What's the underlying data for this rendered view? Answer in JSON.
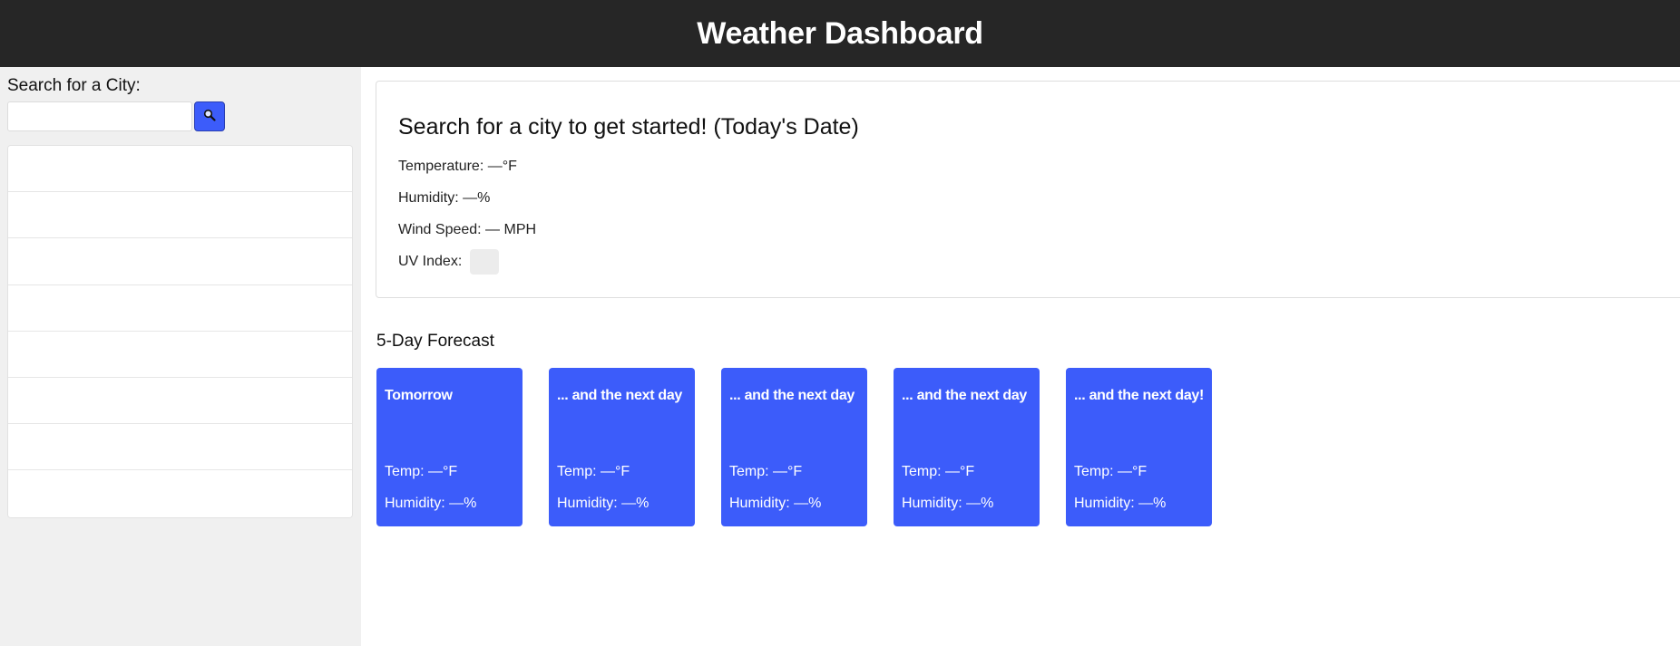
{
  "header": {
    "title": "Weather Dashboard"
  },
  "sidebar": {
    "search_label": "Search for a City:",
    "search_value": "",
    "history": [
      "",
      "",
      "",
      "",
      "",
      "",
      "",
      ""
    ]
  },
  "current": {
    "heading": "Search for a city to get started! (Today's Date)",
    "temperature": "Temperature: —°F",
    "humidity": "Humidity: —%",
    "wind": "Wind Speed: — MPH",
    "uv_label": "UV Index:",
    "uv_value": "—"
  },
  "forecast": {
    "title": "5-Day Forecast",
    "cards": [
      {
        "day": "Tomorrow",
        "temp": "Temp: —°F",
        "humidity": "Humidity: —%"
      },
      {
        "day": "... and the next day",
        "temp": "Temp: —°F",
        "humidity": "Humidity: —%"
      },
      {
        "day": "... and the next day",
        "temp": "Temp: —°F",
        "humidity": "Humidity: —%"
      },
      {
        "day": "... and the next day",
        "temp": "Temp: —°F",
        "humidity": "Humidity: —%"
      },
      {
        "day": "... and the next day!",
        "temp": "Temp: —°F",
        "humidity": "Humidity: —%"
      }
    ]
  },
  "colors": {
    "header_bg": "#262626",
    "accent": "#3c5cfa",
    "sidebar_bg": "#f0f0f0"
  },
  "icons": {
    "search_button": "search-icon"
  }
}
